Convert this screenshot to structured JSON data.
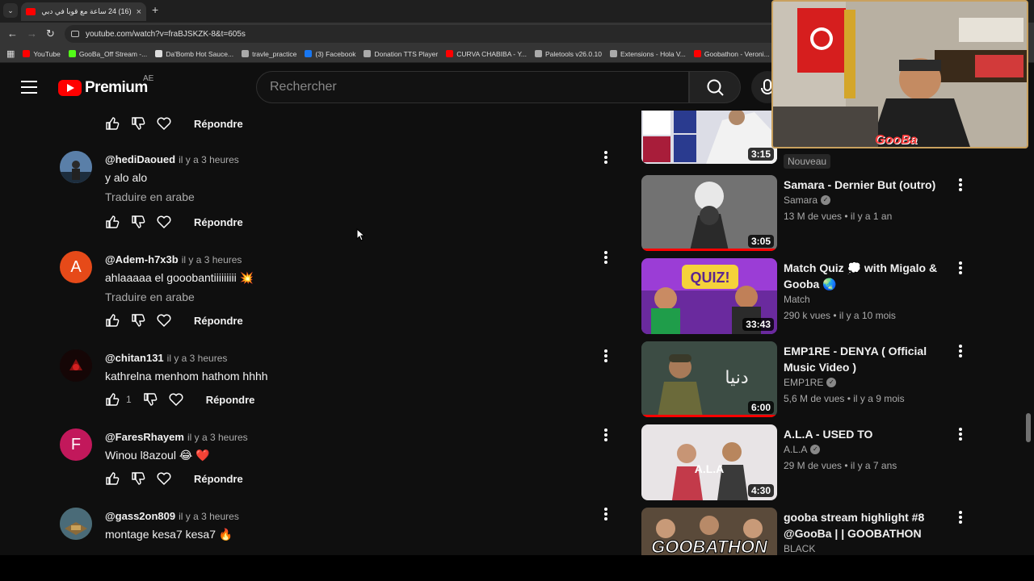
{
  "browser": {
    "tab_title": "(16) 24 ساعة مع قوبا في دبي - ...",
    "url": "youtube.com/watch?v=fraBJSKZK-8&t=605s",
    "bookmarks": [
      {
        "label": "YouTube",
        "color": "#ff0000"
      },
      {
        "label": "GooBa_Off Stream -...",
        "color": "#53fc18"
      },
      {
        "label": "Da'Bomb Hot Sauce...",
        "color": "#dddddd"
      },
      {
        "label": "travle_practice",
        "color": "#aaaaaa"
      },
      {
        "label": "(3) Facebook",
        "color": "#1877f2"
      },
      {
        "label": "Donation TTS Player",
        "color": "#aaaaaa"
      },
      {
        "label": "CURVA CHABIBA - Y...",
        "color": "#ff0000"
      },
      {
        "label": "Paletools v26.0.10",
        "color": "#aaaaaa"
      },
      {
        "label": "Extensions - Hola V...",
        "color": "#aaaaaa"
      },
      {
        "label": "Goobathon - Veroni...",
        "color": "#ff0000"
      }
    ]
  },
  "header": {
    "logo_text": "Premium",
    "country": "AE",
    "search_placeholder": "Rechercher"
  },
  "actions": {
    "reply_label": "Répondre"
  },
  "comments": [
    {
      "author": "@hediDaoued",
      "time": "il y a 3 heures",
      "text": "y alo alo",
      "translate": "Traduire en arabe",
      "avatar_letter": "",
      "avatar_color": "#2d4a6b"
    },
    {
      "author": "@Adem-h7x3b",
      "time": "il y a 3 heures",
      "text": "ahlaaaaa el gooobantiiiiiiiii 💥",
      "translate": "Traduire en arabe",
      "avatar_letter": "A",
      "avatar_color": "#e64a19"
    },
    {
      "author": "@chitan131",
      "time": "il y a 3 heures",
      "text": "kathrelna menhom hathom hhhh",
      "like_count": "1",
      "avatar_letter": "",
      "avatar_color": "#3a0d0d"
    },
    {
      "author": "@FaresRhayem",
      "time": "il y a 3 heures",
      "text": "Winou l8azoul 😂 ❤️",
      "avatar_letter": "F",
      "avatar_color": "#c2185b"
    },
    {
      "author": "@gass2on809",
      "time": "il y a 3 heures",
      "text": "montage kesa7 kesa7 🔥",
      "avatar_letter": "",
      "avatar_color": "#3a5a3a"
    }
  ],
  "recommendations": [
    {
      "title": "",
      "channel": "",
      "meta": "",
      "duration": "3:15",
      "badge": "Nouveau"
    },
    {
      "title": "Samara - Dernier But (outro)",
      "channel": "Samara",
      "verified": true,
      "meta": "13 M de vues • il y a 1 an",
      "duration": "3:05"
    },
    {
      "title": "Match Quiz 💭 with Migalo & Gooba 🌏",
      "channel": "Match",
      "verified": false,
      "meta": "290 k vues • il y a 10 mois",
      "duration": "33:43"
    },
    {
      "title": "EMP1RE - DENYA ( Official Music Video )",
      "channel": "EMP1RE",
      "verified": true,
      "meta": "5,6 M de vues • il y a 9 mois",
      "duration": "6:00"
    },
    {
      "title": "A.L.A - USED TO",
      "channel": "A.L.A",
      "verified": true,
      "meta": "29 M de vues • il y a 7 ans",
      "duration": "4:30"
    },
    {
      "title": "gooba stream highlight #8 @GooBa | | GOOBATHON",
      "channel": "BLACK",
      "verified": false,
      "meta": "",
      "duration": ""
    }
  ],
  "overlay": {
    "streamer_name": "GooBa"
  }
}
